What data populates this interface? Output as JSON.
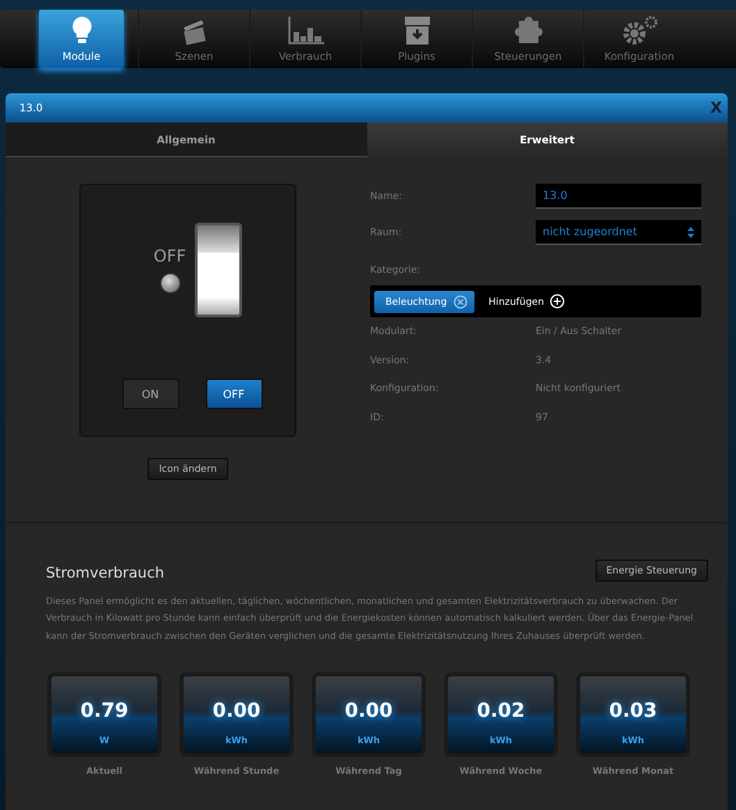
{
  "nav": {
    "items": [
      {
        "label": "Module",
        "kind": "bulb",
        "selected": true
      },
      {
        "label": "Szenen",
        "kind": "clapper",
        "selected": false
      },
      {
        "label": "Verbrauch",
        "kind": "chart",
        "selected": false
      },
      {
        "label": "Plugins",
        "kind": "box",
        "selected": false
      },
      {
        "label": "Steuerungen",
        "kind": "puzzle",
        "selected": false
      },
      {
        "label": "Konfiguration",
        "kind": "gears",
        "selected": false
      }
    ]
  },
  "dialog": {
    "title": "13.0",
    "close": "X",
    "tabs": [
      {
        "label": "Allgemein",
        "selected": false
      },
      {
        "label": "Erweitert",
        "selected": true
      }
    ],
    "switch": {
      "state_label": "OFF",
      "on": false,
      "buttons": [
        {
          "label": "ON",
          "selected": false
        },
        {
          "label": "OFF",
          "selected": true
        }
      ],
      "icon_button": "Icon ändern"
    },
    "fields": [
      {
        "label": "Name:",
        "kind": "input",
        "value": "13.0"
      },
      {
        "label": "Raum:",
        "kind": "select",
        "value": "nicht zugeordnet"
      }
    ],
    "category": {
      "label": "Kategorie:",
      "tags": [
        "Beleuchtung"
      ],
      "add": "Hinzufügen"
    },
    "info": [
      {
        "label": "Modulart:",
        "value": "Ein / Aus Schalter"
      },
      {
        "label": "Version:",
        "value": "3.4"
      },
      {
        "label": "Konfiguration:",
        "value": "Nicht konfiguriert"
      },
      {
        "label": "ID:",
        "value": "97"
      }
    ],
    "energy": {
      "title": "Stromverbrauch",
      "button": "Energie Steuerung",
      "description": "Dieses Panel ermöglicht es den aktuellen, täglichen, wöchentlichen, monatlichen und gesamten Elektrizitätsverbrauch zu überwachen. Der Verbrauch in Kilowatt pro Stunde kann einfach überprüft und die Energiekosten können automatisch kalkuliert werden. Über das Energie-Panel kann der Stromverbrauch zwischen den Geräten verglichen und die gesamte Elektrizitätsnutzung Ihres Zuhauses überprüft werden.",
      "meters": [
        {
          "value": "0.79",
          "unit": "W",
          "label": "Aktuell"
        },
        {
          "value": "0.00",
          "unit": "kWh",
          "label": "Während Stunde"
        },
        {
          "value": "0.00",
          "unit": "kWh",
          "label": "Während Tag"
        },
        {
          "value": "0.02",
          "unit": "kWh",
          "label": "Während Woche"
        },
        {
          "value": "0.03",
          "unit": "kWh",
          "label": "Während Monat"
        }
      ]
    }
  }
}
